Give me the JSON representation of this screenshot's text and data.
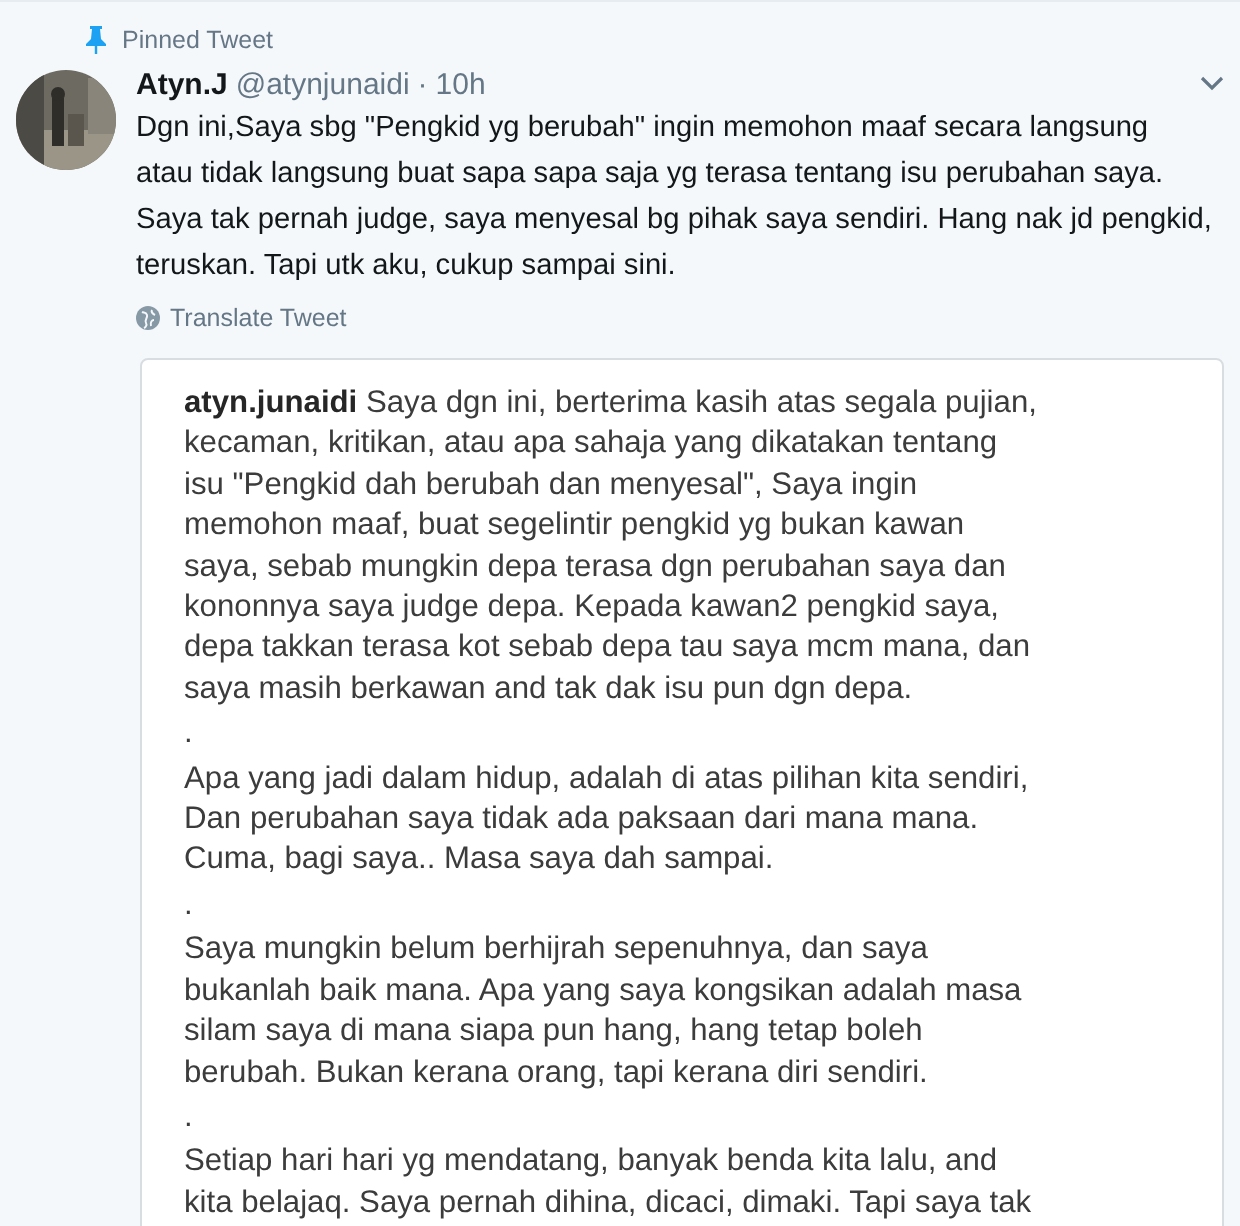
{
  "pinned_label": "Pinned Tweet",
  "tweet": {
    "name": "Atyn.J",
    "handle": "@atynjunaidi",
    "separator": "·",
    "time": "10h",
    "text": "Dgn ini,Saya sbg \"Pengkid yg berubah\" ingin memohon maaf secara langsung\natau tidak langsung buat sapa sapa saja yg terasa tentang isu perubahan saya.\nSaya tak pernah judge, saya menyesal bg pihak saya sendiri. Hang nak jd pengkid,\nteruskan. Tapi utk aku, cukup sampai sini.",
    "translate": "Translate Tweet"
  },
  "attached_image": {
    "paragraphs": [
      "**atyn.junaidi** Saya dgn ini, berterima kasih atas segala pujian,\nkecaman, kritikan, atau apa sahaja yang dikatakan tentang\nisu \"Pengkid dah berubah dan menyesal\", Saya ingin\nmemohon maaf, buat segelintir pengkid yg bukan kawan\nsaya, sebab mungkin depa terasa dgn perubahan saya dan\nkononnya saya judge depa. Kepada kawan2 pengkid saya,\ndepa takkan terasa kot sebab depa tau saya mcm mana, dan\nsaya masih berkawan and tak dak isu pun dgn depa.",
      ".",
      "Apa yang jadi dalam hidup, adalah di atas pilihan kita sendiri,\nDan perubahan saya tidak ada paksaan dari mana mana.\nCuma, bagi saya.. Masa saya dah sampai.",
      ".",
      "Saya mungkin belum berhijrah sepenuhnya, dan saya\nbukanlah baik mana. Apa yang saya kongsikan adalah masa\nsilam saya di mana siapa pun hang, hang tetap boleh\nberubah. Bukan kerana orang, tapi kerana diri sendiri.",
      ".",
      "Setiap hari hari yg mendatang, banyak benda kita lalu, and\nkita belajaq. Saya pernah dihina, dicaci, dimaki. Tapi saya tak"
    ]
  }
}
